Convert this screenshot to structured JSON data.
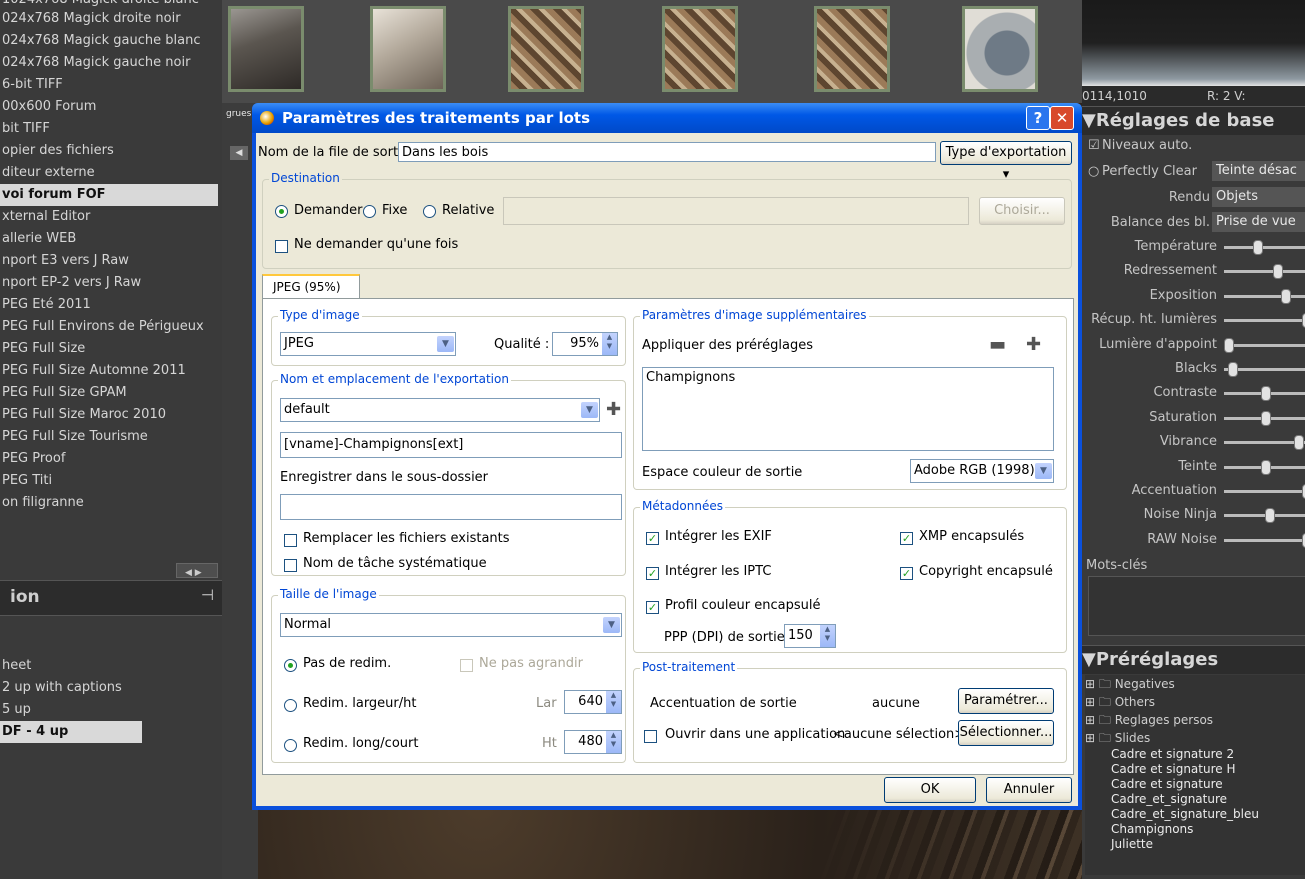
{
  "left_panel": {
    "items": [
      "1024x768 Magick droite blanc",
      "024x768 Magick droite noir",
      "024x768 Magick gauche blanc",
      "024x768 Magick gauche noir",
      "6-bit TIFF",
      "00x600 Forum",
      "bit TIFF",
      "opier des fichiers",
      "diteur externe",
      "voi forum FOF",
      "xternal Editor",
      "allerie WEB",
      "nport E3 vers J Raw",
      "nport EP-2 vers J Raw",
      "PEG Eté 2011",
      "PEG Full Environs de Périgueux",
      "PEG Full Size",
      "PEG Full Size Automne 2011",
      "PEG Full Size GPAM",
      "PEG Full Size Maroc 2010",
      "PEG Full Size Tourisme",
      "PEG Proof",
      "PEG Titi",
      "on filigranne"
    ],
    "selected_index": 9,
    "section_title": "ion",
    "items2": [
      "heet",
      "2 up with captions",
      "5 up",
      "DF - 4 up"
    ],
    "selected2_index": 3
  },
  "photo_strip_text": "grues",
  "right_panel": {
    "coords": "0114,1010",
    "readout": "R:  2 V:",
    "reglages_title": "Réglages de base",
    "niveaux": "Niveaux auto.",
    "perfectly_clear": "Perfectly Clear",
    "perfectly_clear_value": "Teinte désac",
    "rendu_label": "Rendu",
    "rendu_value": "Objets",
    "balance_label": "Balance des bl.",
    "balance_value": "Prise de vue",
    "sliders": [
      {
        "label": "Température",
        "pos": 0.35
      },
      {
        "label": "Redressement",
        "pos": 0.6
      },
      {
        "label": "Exposition",
        "pos": 0.7
      },
      {
        "label": "Récup. ht. lumières",
        "pos": 0.95
      },
      {
        "label": "Lumière d'appoint",
        "pos": 0.0
      },
      {
        "label": "Blacks",
        "pos": 0.05
      },
      {
        "label": "Contraste",
        "pos": 0.45
      },
      {
        "label": "Saturation",
        "pos": 0.45
      },
      {
        "label": "Vibrance",
        "pos": 0.85
      },
      {
        "label": "Teinte",
        "pos": 0.45
      },
      {
        "label": "Accentuation",
        "pos": 0.95
      },
      {
        "label": "Noise Ninja",
        "pos": 0.5
      },
      {
        "label": "RAW Noise",
        "pos": 0.95
      }
    ],
    "mots_cles": "Mots-clés",
    "presets_title": "Préréglages",
    "preset_folders": [
      "Negatives",
      "Others",
      "Reglages persos",
      "Slides"
    ],
    "preset_items": [
      "Cadre et signature 2",
      "Cadre et signature H",
      "Cadre et signature",
      "Cadre_et_signature",
      "Cadre_et_signature_bleu",
      "Champignons",
      "Juliette"
    ]
  },
  "dialog": {
    "title": "Paramètres des traitements par lots",
    "help_glyph": "?",
    "close_glyph": "✕",
    "output_name_label": "Nom de la file de sortie",
    "output_name_value": "Dans les bois",
    "export_type_label": "Type d'exportation",
    "destination": {
      "label": "Destination",
      "option_demander": "Demander",
      "option_fixe": "Fixe",
      "option_relative": "Relative",
      "path_value": "",
      "choose_button": "Choisir...",
      "ask_once": "Ne demander qu'une fois"
    },
    "tab_label": "JPEG (95%)",
    "image_type": {
      "label": "Type d'image",
      "value": "JPEG",
      "quality_label": "Qualité :",
      "quality_value": "95%"
    },
    "naming": {
      "label": "Nom et emplacement de l'exportation",
      "preset": "default",
      "template": "[vname]-Champignons[ext]",
      "subfolder_label": "Enregistrer dans le sous-dossier",
      "subfolder_value": "",
      "replace_label": "Remplacer les fichiers existants",
      "task_name_label": "Nom de tâche systématique"
    },
    "size": {
      "label": "Taille de l'image",
      "value": "Normal",
      "no_resize": "Pas de redim.",
      "no_enlarge": "Ne pas agrandir",
      "resize_wh": "Redim. largeur/ht",
      "resize_long": "Redim. long/court",
      "width_label": "Lar",
      "width_value": "640",
      "height_label": "Ht",
      "height_value": "480"
    },
    "extra": {
      "label": "Paramètres d'image supplémentaires",
      "apply_presets": "Appliquer des préréglages",
      "presets_list": [
        "Champignons"
      ],
      "color_space_label": "Espace couleur de sortie",
      "color_space_value": "Adobe RGB (1998)"
    },
    "metadata": {
      "label": "Métadonnées",
      "exif": "Intégrer les EXIF",
      "xmp": "XMP encapsulés",
      "iptc": "Intégrer les IPTC",
      "copyright": "Copyright encapsulé",
      "color_profile": "Profil couleur encapsulé",
      "dpi_label": "PPP (DPI) de sortie",
      "dpi_value": "150"
    },
    "post": {
      "label": "Post-traitement",
      "sharpen_label": "Accentuation de sortie",
      "sharpen_value": "aucune",
      "configure_button": "Paramétrer...",
      "open_app_label": "Ouvrir dans une application",
      "open_app_value": "<aucune sélection>",
      "select_button": "Sélectionner..."
    },
    "ok_button": "OK",
    "cancel_button": "Annuler"
  }
}
